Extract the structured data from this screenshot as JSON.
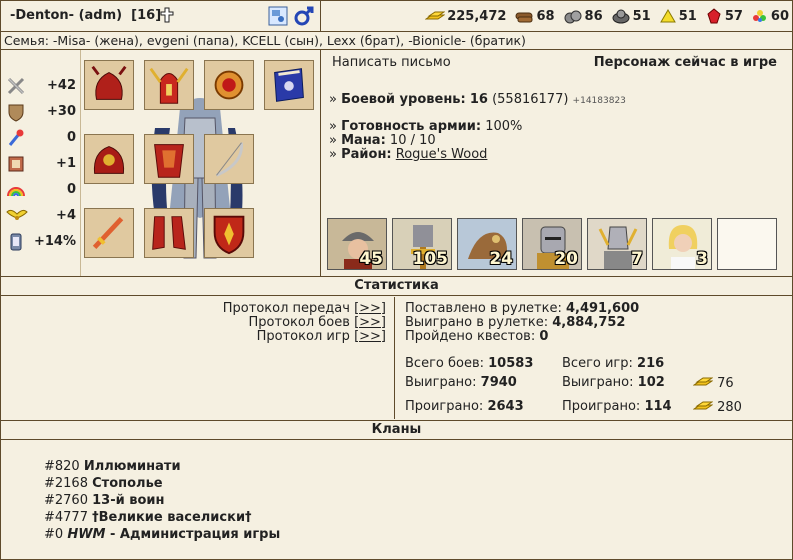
{
  "header": {
    "name": "-Denton- (adm)",
    "level": "[16]",
    "cross_icon": "cross-icon",
    "resources": [
      {
        "name": "gold",
        "icon": "gold-icon",
        "value": "225,472"
      },
      {
        "name": "wood",
        "icon": "wood-icon",
        "value": "68"
      },
      {
        "name": "ore",
        "icon": "ore-icon",
        "value": "86"
      },
      {
        "name": "mercury",
        "icon": "mercury-icon",
        "value": "51"
      },
      {
        "name": "sulfur",
        "icon": "sulfur-icon",
        "value": "51"
      },
      {
        "name": "crystals",
        "icon": "crystals-icon",
        "value": "57"
      },
      {
        "name": "gems",
        "icon": "gems-icon",
        "value": "60"
      }
    ]
  },
  "family": "Семья: -Misa- (жена), evgeni (папа), KCELL (сын), Lexx (брат), -Bionicle- (братик)",
  "stats": [
    {
      "icon": "attack-icon",
      "value": "+42"
    },
    {
      "icon": "defense-icon",
      "value": "+30"
    },
    {
      "icon": "spellpower-icon",
      "value": "0"
    },
    {
      "icon": "knowledge-icon",
      "value": "+1"
    },
    {
      "icon": "luck-icon",
      "value": "0"
    },
    {
      "icon": "morale-icon",
      "value": "+4"
    },
    {
      "icon": "initiative-icon",
      "value": "+14%"
    }
  ],
  "info": {
    "write_letter": "Написать письмо",
    "online_status": "Персонаж сейчас в игре",
    "combat_label": "Боевой уровень:",
    "combat_level": "16",
    "combat_exp": "(55816177)",
    "combat_exp_gain": "+14183823",
    "army_ready_label": "Готовность армии:",
    "army_ready": "100%",
    "mana_label": "Мана:",
    "mana": "10 / 10",
    "district_label": "Район:",
    "district": "Rogue's Wood",
    "bullet": "»"
  },
  "army": [
    {
      "name": "unit-archer",
      "count": "45"
    },
    {
      "name": "unit-knight",
      "count": "105"
    },
    {
      "name": "unit-griffin",
      "count": "24"
    },
    {
      "name": "unit-crusader",
      "count": "20"
    },
    {
      "name": "unit-paladin",
      "count": "7"
    },
    {
      "name": "unit-angel",
      "count": "3"
    },
    {
      "name": "unit-empty",
      "count": ""
    }
  ],
  "statistics": {
    "title": "Статистика",
    "protocols": [
      {
        "label": "Протокол передач",
        "link": "[>>]"
      },
      {
        "label": "Протокол боев",
        "link": "[>>]"
      },
      {
        "label": "Протокол игр",
        "link": "[>>]"
      }
    ],
    "roulette_bet_label": "Поставлено в рулетке:",
    "roulette_bet": "4,491,600",
    "roulette_won_label": "Выиграно в рулетке:",
    "roulette_won": "4,884,752",
    "quests_label": "Пройдено квестов:",
    "quests": "0",
    "battles_total_label": "Всего боев:",
    "battles_total": "10583",
    "battles_won_label": "Выиграно:",
    "battles_won": "7940",
    "battles_lost_label": "Проиграно:",
    "battles_lost": "2643",
    "games_total_label": "Всего игр:",
    "games_total": "216",
    "games_won_label": "Выиграно:",
    "games_won": "102",
    "games_lost_label": "Проиграно:",
    "games_lost": "114",
    "gold_won": "76",
    "gold_lost": "280"
  },
  "clans": {
    "title": "Кланы",
    "list": [
      {
        "id": "#820",
        "name": "Иллюминати"
      },
      {
        "id": "#2168",
        "name": "Стополье"
      },
      {
        "id": "#2760",
        "name": "13-й воин"
      },
      {
        "id": "#4777",
        "name": "†Великие васелиски†"
      },
      {
        "id": "#0",
        "name_italic": "HWM",
        "name": " - Администрация игры"
      }
    ]
  }
}
